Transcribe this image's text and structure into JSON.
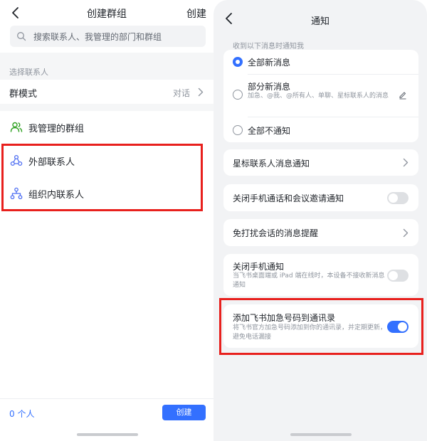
{
  "left": {
    "header": {
      "title": "创建群组",
      "create_label": "创建"
    },
    "search": {
      "placeholder": "搜索联系人、我管理的部门和群组"
    },
    "section_label": "选择联系人",
    "group_type": {
      "label": "群模式",
      "value": "对话"
    },
    "rows": [
      {
        "label": "我管理的群组",
        "icon": "managed-groups-icon"
      },
      {
        "label": "外部联系人",
        "icon": "external-contacts-icon"
      },
      {
        "label": "组织内联系人",
        "icon": "org-contacts-icon"
      }
    ],
    "footer": {
      "count": "0 个人",
      "create_button": "创建"
    }
  },
  "right": {
    "header": {
      "title": "通知"
    },
    "hint": "收到以下消息时通知我",
    "options": [
      {
        "label": "全部新消息",
        "selected": true
      },
      {
        "label": "部分新消息",
        "sub": "加急、@我、@所有人、单聊、星标联系人的消息",
        "selected": false
      },
      {
        "label": "全部不通知",
        "selected": false
      }
    ],
    "star_contacts": {
      "label": "星标联系人消息通知"
    },
    "close_calls": {
      "label": "关闭手机通话和会议邀请通知",
      "enabled": false
    },
    "dnd_reminder": {
      "label": "免打扰会话的消息提醒"
    },
    "close_mobile": {
      "label": "关闭手机通知",
      "sub": "当飞书桌面端或 iPad 端在线时，本设备不接收新消息通知",
      "enabled": false
    },
    "add_numbers": {
      "label": "添加飞书加急号码到通讯录",
      "sub": "将飞书官方加急号码添加到你的通讯录，并定期更新，避免电话漏接",
      "enabled": true
    }
  },
  "colors": {
    "accent": "#3370ff",
    "highlight": "#e8201d",
    "muted": "#8f959e",
    "icon_green": "#2ea121"
  }
}
